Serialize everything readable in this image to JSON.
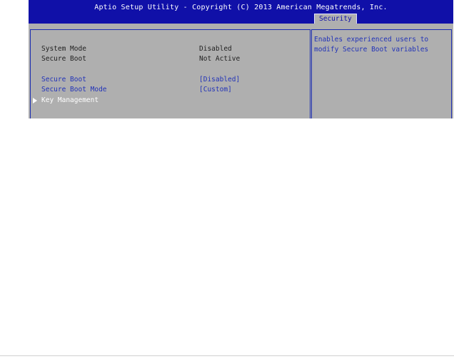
{
  "header": {
    "title": "Aptio Setup Utility - Copyright (C) 2013 American Megatrends, Inc.",
    "active_tab": "Security"
  },
  "colors": {
    "header_bg": "#1010a8",
    "panel_bg": "#afafaf",
    "link": "#2233b8"
  },
  "status": {
    "system_mode_label": "System Mode",
    "system_mode_value": "Disabled",
    "secure_boot_label": "Secure Boot",
    "secure_boot_value": "Not Active"
  },
  "options": {
    "secure_boot_label": "Secure Boot",
    "secure_boot_value": "[Disabled]",
    "secure_boot_mode_label": "Secure Boot Mode",
    "secure_boot_mode_value": "[Custom]",
    "key_management_label": "Key Management"
  },
  "help": {
    "text": "Enables experienced users to\nmodify Secure Boot variables"
  }
}
